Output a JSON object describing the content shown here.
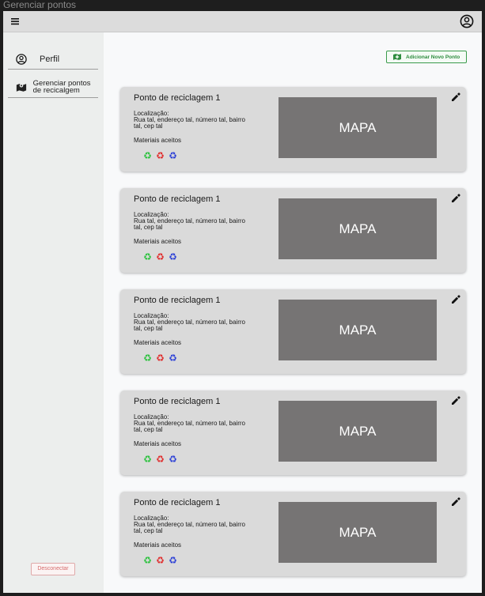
{
  "window": {
    "title": "Gerenciar pontos"
  },
  "sidebar": {
    "items": [
      {
        "label": "Perfil",
        "icon": "user-circle-icon"
      },
      {
        "label": "Gerenciar pontos de recicalgem",
        "icon": "map-pin-icon"
      }
    ],
    "logout_label": "Desconectar"
  },
  "main": {
    "add_button_label": "Adicionar Novo Ponto",
    "cards": [
      {
        "title": "Ponto de reciclagem 1",
        "location_label": "Localização:",
        "location": "Rua tal, endereço tal, número tal, bairro tal, cep tal",
        "materials_label": "Materiais aceitos",
        "map_label": "MAPA"
      },
      {
        "title": "Ponto de reciclagem 1",
        "location_label": "Localização:",
        "location": "Rua tal, endereço tal, número tal, bairro tal, cep tal",
        "materials_label": "Materiais aceitos",
        "map_label": "MAPA"
      },
      {
        "title": "Ponto de reciclagem 1",
        "location_label": "Localização:",
        "location": "Rua tal, endereço tal, número tal, bairro tal, cep tal",
        "materials_label": "Materiais aceitos",
        "map_label": "MAPA"
      },
      {
        "title": "Ponto de reciclagem 1",
        "location_label": "Localização:",
        "location": "Rua tal, endereço tal, número tal, bairro tal, cep tal",
        "materials_label": "Materiais aceitos",
        "map_label": "MAPA"
      },
      {
        "title": "Ponto de reciclagem 1",
        "location_label": "Localização:",
        "location": "Rua tal, endereço tal, número tal, bairro tal, cep tal",
        "materials_label": "Materiais aceitos",
        "map_label": "MAPA"
      }
    ],
    "material_icons": [
      {
        "name": "recycle-icon-green",
        "glyph": "♻",
        "color": "#2bc23d"
      },
      {
        "name": "recycle-icon-red",
        "glyph": "♻",
        "color": "#e02b2b"
      },
      {
        "name": "recycle-icon-blue",
        "glyph": "♻",
        "color": "#2b3fd6"
      }
    ]
  },
  "colors": {
    "accent_green": "#2e8c3f",
    "logout_red": "#d76c6c",
    "map_gray": "#767474"
  }
}
